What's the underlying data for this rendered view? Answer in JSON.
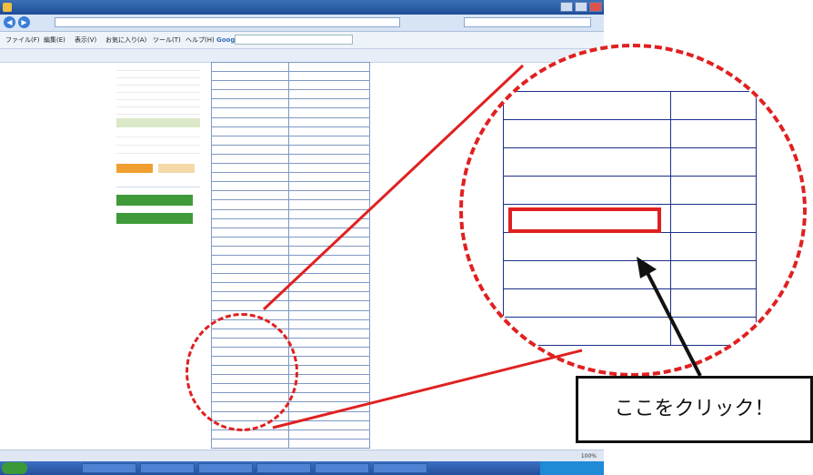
{
  "browser": {
    "title": "",
    "address": "",
    "search_placeholder": "",
    "menu": [
      "ファイル(F)",
      "編集(E)",
      "表示(V)",
      "お気に入り(A)",
      "ツール(T)",
      "ヘルプ(H)"
    ],
    "google_label": "Google",
    "favorites": []
  },
  "sidebar": {
    "options": [],
    "headers": [],
    "buttons": []
  },
  "route_table": {
    "rows": [
      {
        "c1": "",
        "c2": "",
        "highlight": false
      },
      {
        "c1": "",
        "c2": "",
        "highlight": false
      },
      {
        "c1": "",
        "c2": "",
        "highlight": false
      },
      {
        "c1": "",
        "c2": "",
        "highlight": false
      },
      {
        "c1": "",
        "c2": "",
        "highlight": false
      },
      {
        "c1": "",
        "c2": "",
        "highlight": false
      },
      {
        "c1": "",
        "c2": "",
        "highlight": false
      },
      {
        "c1": "",
        "c2": "",
        "highlight": false
      },
      {
        "c1": "",
        "c2": "",
        "highlight": false
      },
      {
        "c1": "",
        "c2": "",
        "highlight": false
      },
      {
        "c1": "",
        "c2": "",
        "highlight": false
      },
      {
        "c1": "",
        "c2": "",
        "highlight": false
      },
      {
        "c1": "",
        "c2": "",
        "highlight": false
      },
      {
        "c1": "",
        "c2": "",
        "highlight": false
      },
      {
        "c1": "",
        "c2": "",
        "highlight": false
      },
      {
        "c1": "",
        "c2": "",
        "highlight": false
      },
      {
        "c1": "",
        "c2": "",
        "highlight": false
      },
      {
        "c1": "",
        "c2": "",
        "highlight": false
      },
      {
        "c1": "",
        "c2": "",
        "highlight": false
      },
      {
        "c1": "",
        "c2": "",
        "highlight": false
      },
      {
        "c1": "",
        "c2": "",
        "highlight": false
      },
      {
        "c1": "",
        "c2": "",
        "highlight": false
      },
      {
        "c1": "",
        "c2": "",
        "highlight": false
      },
      {
        "c1": "",
        "c2": "",
        "highlight": false
      },
      {
        "c1": "",
        "c2": "",
        "highlight": false
      },
      {
        "c1": "",
        "c2": "",
        "highlight": false
      },
      {
        "c1": "",
        "c2": "",
        "highlight": false
      },
      {
        "c1": "",
        "c2": "",
        "highlight": false
      },
      {
        "c1": "",
        "c2": "",
        "highlight": false
      },
      {
        "c1": "",
        "c2": "",
        "highlight": false
      },
      {
        "c1": "",
        "c2": "",
        "highlight": false
      },
      {
        "c1": "",
        "c2": "",
        "highlight": false
      },
      {
        "c1": "",
        "c2": "",
        "highlight": false
      },
      {
        "c1": "",
        "c2": "",
        "highlight": false
      },
      {
        "c1": "",
        "c2": "",
        "highlight": false
      },
      {
        "c1": "",
        "c2": "",
        "highlight": false
      },
      {
        "c1": "",
        "c2": "",
        "highlight": true
      },
      {
        "c1": "",
        "c2": "",
        "highlight": false
      },
      {
        "c1": "",
        "c2": "",
        "highlight": false
      },
      {
        "c1": "",
        "c2": "",
        "highlight": false
      },
      {
        "c1": "",
        "c2": "",
        "highlight": false
      },
      {
        "c1": "",
        "c2": "",
        "highlight": false
      }
    ]
  },
  "zoom_table": {
    "rows": [
      {
        "c1": "",
        "c2": "",
        "highlight": false
      },
      {
        "c1": "",
        "c2": "",
        "highlight": false
      },
      {
        "c1": "",
        "c2": "",
        "highlight": false
      },
      {
        "c1": "",
        "c2": "",
        "highlight": false
      },
      {
        "c1": "",
        "c2": "",
        "highlight": false
      },
      {
        "c1": "",
        "c2": "",
        "highlight": false
      },
      {
        "c1": "",
        "c2": "",
        "highlight": true
      },
      {
        "c1": "",
        "c2": "",
        "highlight": false
      },
      {
        "c1": "",
        "c2": "",
        "highlight": false
      }
    ]
  },
  "footer_links": "",
  "status": {
    "left": "",
    "right": "",
    "zoom": "100%"
  },
  "taskbar": {
    "items": [],
    "clock": ""
  },
  "callout": {
    "text": "ここをクリック！"
  },
  "colors": {
    "annotation_red": "#e02020",
    "link_blue": "#1a4fb8",
    "ie_blue": "#2a5bab"
  }
}
